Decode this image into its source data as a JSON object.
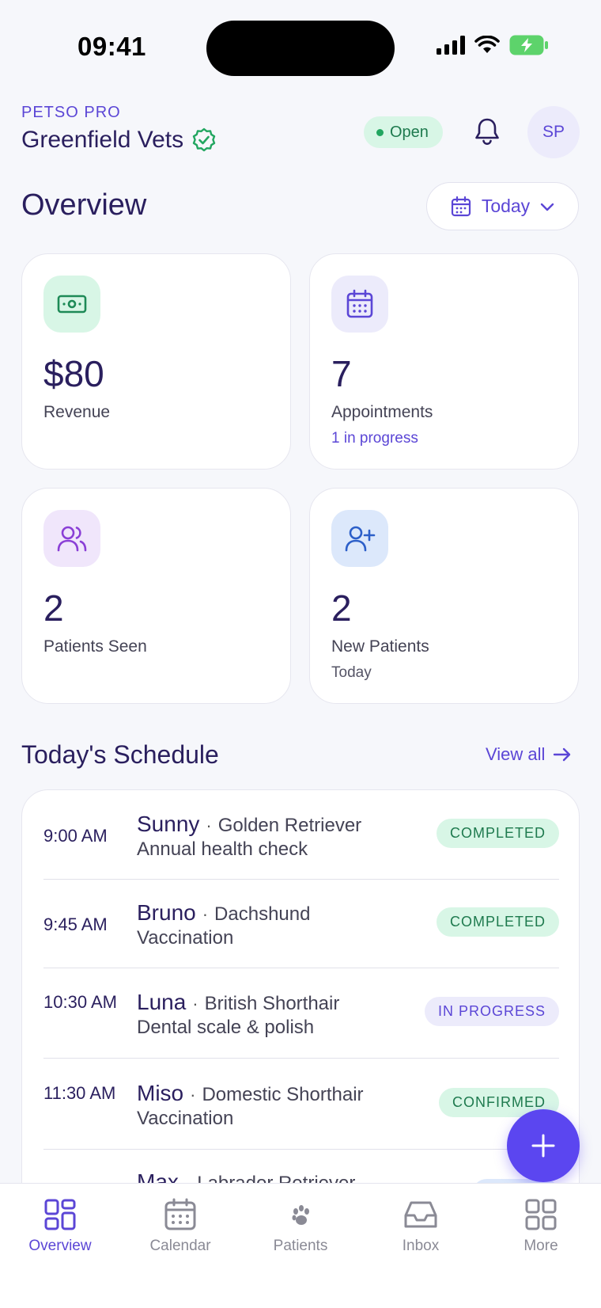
{
  "status_bar": {
    "time": "09:41"
  },
  "header": {
    "brand": "PETSO PRO",
    "clinic_name": "Greenfield Vets",
    "status": "Open",
    "avatar_initials": "SP"
  },
  "overview": {
    "title": "Overview",
    "date_filter": "Today"
  },
  "stats": [
    {
      "value": "$80",
      "label": "Revenue",
      "sub": "",
      "icon": "cash-icon"
    },
    {
      "value": "7",
      "label": "Appointments",
      "sub": "1 in progress",
      "icon": "calendar-icon"
    },
    {
      "value": "2",
      "label": "Patients Seen",
      "sub": "",
      "icon": "users-icon"
    },
    {
      "value": "2",
      "label": "New Patients",
      "sub": "Today",
      "icon": "user-plus-icon"
    }
  ],
  "schedule": {
    "title": "Today's Schedule",
    "view_all": "View all",
    "items": [
      {
        "time": "9:00 AM",
        "pet": "Sunny",
        "breed": "Golden Retriever",
        "reason": "Annual health check",
        "status": "COMPLETED"
      },
      {
        "time": "9:45 AM",
        "pet": "Bruno",
        "breed": "Dachshund",
        "reason": "Vaccination",
        "status": "COMPLETED"
      },
      {
        "time": "10:30 AM",
        "pet": "Luna",
        "breed": "British Shorthair",
        "reason": "Dental scale & polish",
        "status": "IN PROGRESS"
      },
      {
        "time": "11:30 AM",
        "pet": "Miso",
        "breed": "Domestic Shorthair",
        "reason": "Vaccination",
        "status": "CONFIRMED"
      },
      {
        "time": "",
        "pet": "Max",
        "breed": "Labrador Retriever",
        "reason": "",
        "status": ""
      }
    ]
  },
  "nav": [
    {
      "label": "Overview",
      "icon": "grid-icon",
      "active": true
    },
    {
      "label": "Calendar",
      "icon": "calendar-icon",
      "active": false
    },
    {
      "label": "Patients",
      "icon": "paw-icon",
      "active": false
    },
    {
      "label": "Inbox",
      "icon": "inbox-icon",
      "active": false
    },
    {
      "label": "More",
      "icon": "more-grid-icon",
      "active": false
    }
  ],
  "colors": {
    "accent": "#5b46d6",
    "fab": "#5b46f0",
    "success_bg": "#d8f6e6",
    "success_text": "#1e7a4e",
    "title": "#2a1f5e"
  }
}
